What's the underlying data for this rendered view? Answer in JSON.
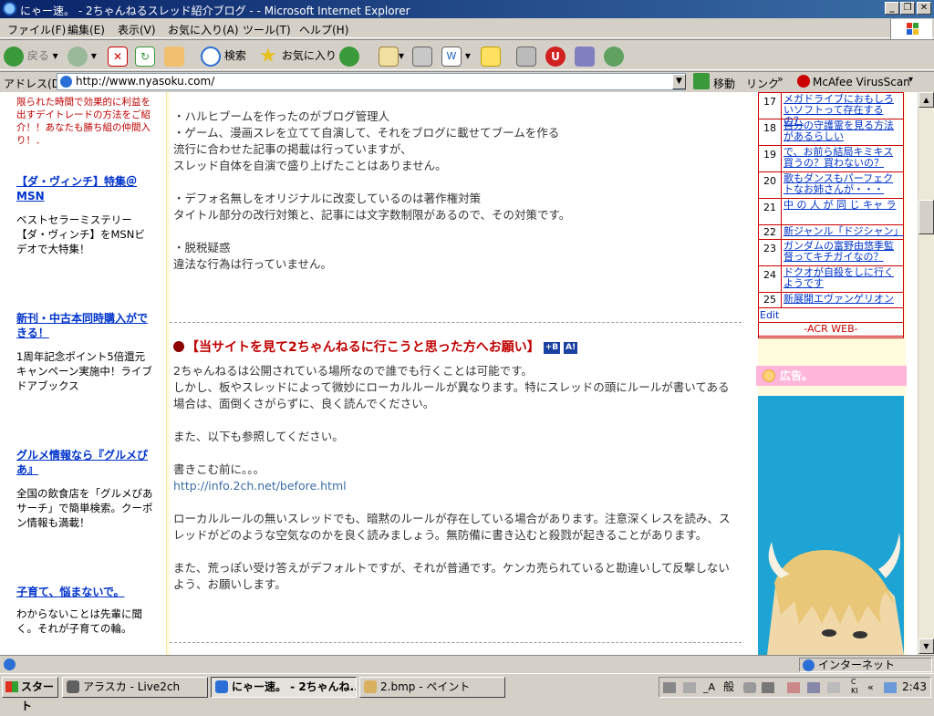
{
  "window": {
    "title": "にゃー速。 - 2ちゃんねるスレッド紹介ブログ - - Microsoft Internet Explorer"
  },
  "menu": [
    "ファイル(F)",
    "編集(E)",
    "表示(V)",
    "お気に入り(A)",
    "ツール(T)",
    "ヘルプ(H)"
  ],
  "toolbar": {
    "back": "戻る",
    "search": "検索",
    "favorites": "お気に入り"
  },
  "address": {
    "label": "アドレス(D)",
    "url": "http://www.nyasoku.com/",
    "go": "移動",
    "links": "リンク",
    "mcafee": "McAfee VirusScan"
  },
  "left_ads": [
    {
      "title": "",
      "text": "限られた時間で効果的に利益を出すデイトレードの方法をご紹介！！あなたも勝ち組の仲間入り！．"
    },
    {
      "title": "【ダ・ヴィンチ】特集＠MSN",
      "text": "ベストセラーミステリー【ダ・ヴィンチ】をMSNビデオで大特集！"
    },
    {
      "title": "新刊・中古本同時購入ができる！",
      "text": "1周年記念ポイント5倍還元キャンペーン実施中！ライブドアブックス"
    },
    {
      "title": "グルメ情報なら『グルメぴあ』",
      "text": "全国の飲食店を「グルメぴあサーチ」で簡単検索。クーポン情報も満載！"
    },
    {
      "title": "子育て、悩まないで。",
      "text": "わからないことは先輩に聞く。それが子育ての輪。"
    }
  ],
  "post1": {
    "lines": [
      "・ハルヒブームを作ったのがブログ管理人",
      "・ゲーム、漫画スレを立てて自演して、それをブログに載せてブームを作る",
      "流行に合わせた記事の掲載は行っていますが、",
      "スレッド自体を自演で盛り上げたことはありません。",
      "・デフォ名無しをオリジナルに改変しているのは著作権対策",
      "タイトル部分の改行対策と、記事には文字数制限があるので、その対策です。",
      "・脱税疑惑",
      "違法な行為は行っていません。"
    ]
  },
  "post2": {
    "title": "【当サイトを見て2ちゃんねるに行こうと思った方へお願い】",
    "badge1": "+B",
    "badge2": "A!",
    "lines": [
      "2ちゃんねるは公開されている場所なので誰でも行くことは可能です。",
      "しかし、板やスレッドによって微妙にローカルルールが異なります。特にスレッドの頭にルールが書いてある",
      "場合は、面倒くさがらずに、良く読んでください。",
      "また、以下も参照してください。",
      "書きこむ前に。。。",
      "http://info.2ch.net/before.html",
      "ローカルルールの無いスレッドでも、暗黙のルールが存在している場合があります。注意深くレスを読み、ス",
      "レッドがどのような空気なのかを良く読みましょう。無防備に書き込むと殺戮が起きることがあります。",
      "また、荒っぽい受け答えがデフォルトですが、それが普通です。ケンカ売られていると勘違いして反撃しない",
      "よう、お願いします。"
    ]
  },
  "ranking": [
    {
      "n": "17",
      "t": "メガドライブにおもしろいソフトって存在するの？"
    },
    {
      "n": "18",
      "t": "自分の守護霊を見る方法があるらしい"
    },
    {
      "n": "19",
      "t": "で、お前ら結局キミキス買うの？買わないの？"
    },
    {
      "n": "20",
      "t": "歌もダンスもパーフェクトなお姉さんが・・・"
    },
    {
      "n": "21",
      "t": "中 の 人 が 同 じ キャ ラ"
    },
    {
      "n": "22",
      "t": "新ジャンル「ドジシャン」"
    },
    {
      "n": "23",
      "t": "ガンダムの富野由悠季監督ってキチガイなの？"
    },
    {
      "n": "24",
      "t": "ドクオが自殺をしに行くようです"
    },
    {
      "n": "25",
      "t": "新展開エヴァンゲリオン"
    }
  ],
  "ranking_edit": "Edit",
  "acr": "-ACR WEB-",
  "ad_header": "広告。",
  "status": {
    "zone": "インターネット"
  },
  "taskbar": {
    "start": "スタート",
    "tasks": [
      "アラスカ - Live2ch",
      "にゃー速。 - 2ちゃんね...",
      "2.bmp - ペイント"
    ],
    "clock": "2:43",
    "ime": "般"
  },
  "colors": {
    "title_start": "#0a246a",
    "accent_red": "#c00000",
    "link": "#0033cc",
    "ad_bg": "#1da4d4",
    "side_bg": "#fffbdc"
  }
}
